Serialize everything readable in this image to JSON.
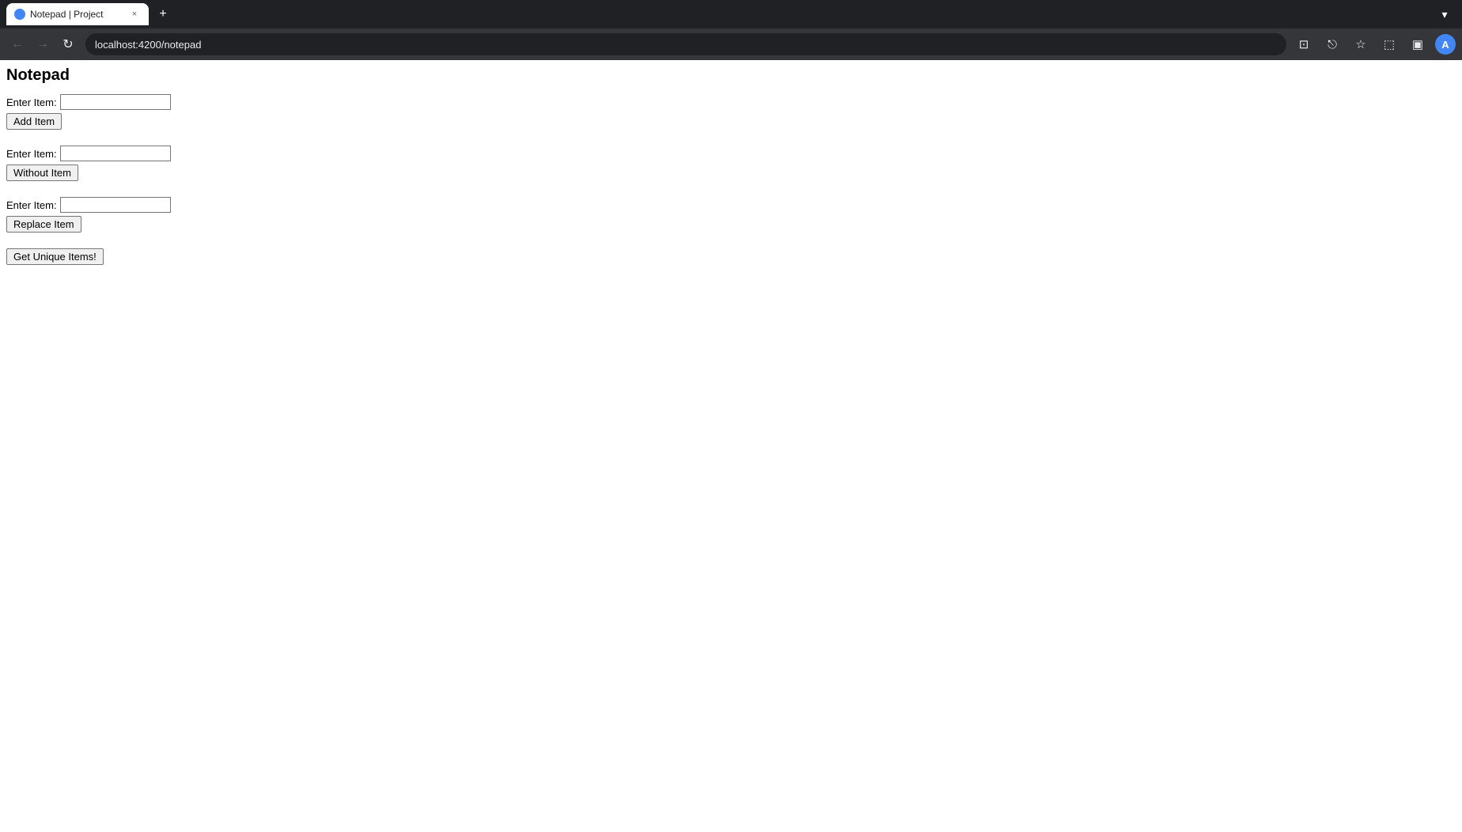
{
  "browser": {
    "tab_title": "Notepad | Project",
    "tab_favicon_label": "notepad-favicon",
    "tab_close_label": "×",
    "new_tab_label": "+",
    "tab_list_label": "▾",
    "nav_back_label": "←",
    "nav_forward_label": "→",
    "nav_refresh_label": "↻",
    "address": "localhost:4200/notepad",
    "icon_reader": "⊡",
    "icon_share": "⎋",
    "icon_bookmark": "☆",
    "icon_extensions": "⬚",
    "icon_sidebar": "▣",
    "profile_label": "A"
  },
  "page": {
    "title": "Notepad",
    "section1": {
      "label": "Enter Item:",
      "input_value": "",
      "button_label": "Add Item"
    },
    "section2": {
      "label": "Enter Item:",
      "input_value": "",
      "button_label": "Without Item"
    },
    "section3": {
      "label": "Enter Item:",
      "input_value": "",
      "button_label": "Replace Item"
    },
    "section4": {
      "button_label": "Get Unique Items!"
    }
  }
}
